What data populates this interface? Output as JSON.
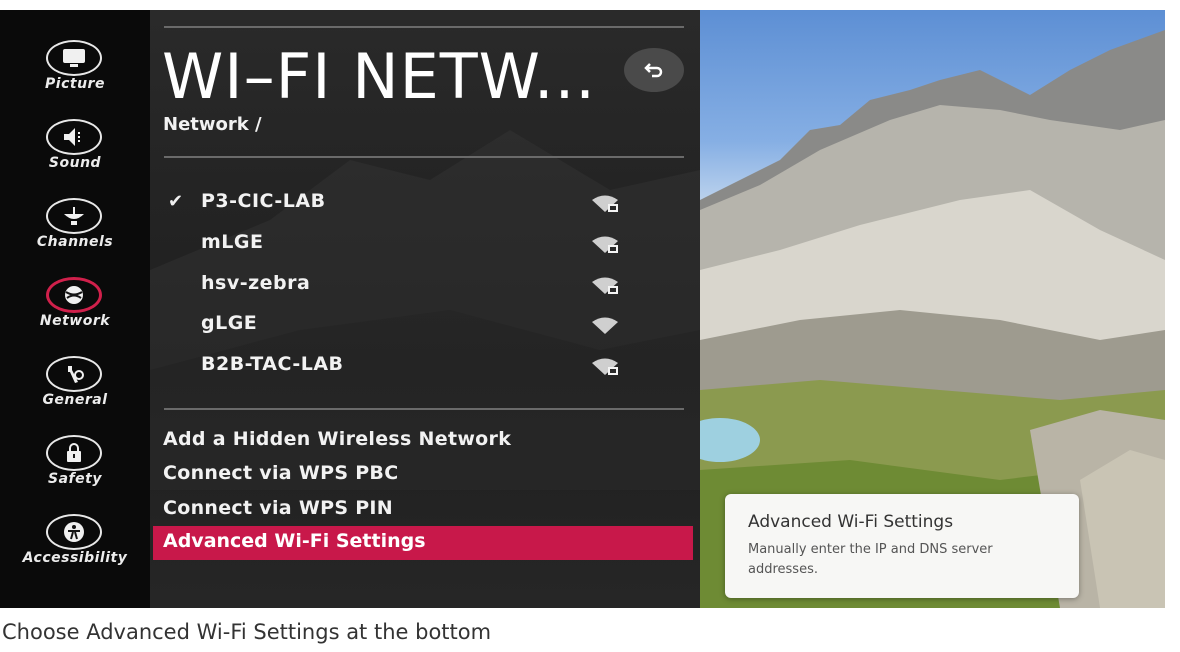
{
  "sidebar": {
    "items": [
      {
        "label": "Picture",
        "icon": "picture-icon"
      },
      {
        "label": "Sound",
        "icon": "speaker-icon"
      },
      {
        "label": "Channels",
        "icon": "satellite-icon"
      },
      {
        "label": "Network",
        "icon": "globe-icon",
        "active": true
      },
      {
        "label": "General",
        "icon": "tools-icon"
      },
      {
        "label": "Safety",
        "icon": "lock-icon"
      },
      {
        "label": "Accessibility",
        "icon": "accessibility-icon"
      }
    ]
  },
  "header": {
    "title": "WI–FI NETW...",
    "breadcrumb": "Network /",
    "back_icon": "back-arrow-icon"
  },
  "networks": [
    {
      "name": "P3-CIC-LAB",
      "connected": true,
      "check": "✔",
      "secured": true
    },
    {
      "name": "mLGE",
      "connected": false,
      "check": "",
      "secured": true
    },
    {
      "name": "hsv-zebra",
      "connected": false,
      "check": "",
      "secured": true
    },
    {
      "name": "gLGE",
      "connected": false,
      "check": "",
      "secured": false
    },
    {
      "name": "B2B-TAC-LAB",
      "connected": false,
      "check": "",
      "secured": true
    }
  ],
  "actions": {
    "hidden": "Add a Hidden Wireless Network",
    "wps_pbc": "Connect via WPS PBC",
    "wps_pin": "Connect via WPS PIN",
    "advanced": "Advanced Wi-Fi Settings"
  },
  "tooltip": {
    "title": "Advanced Wi-Fi Settings",
    "body": "Manually enter the IP and DNS server addresses."
  },
  "caption": "Choose Advanced Wi-Fi Settings at the bottom",
  "colors": {
    "accent": "#c8184a",
    "panel": "#242424",
    "sidebar": "#0a0a0a"
  }
}
